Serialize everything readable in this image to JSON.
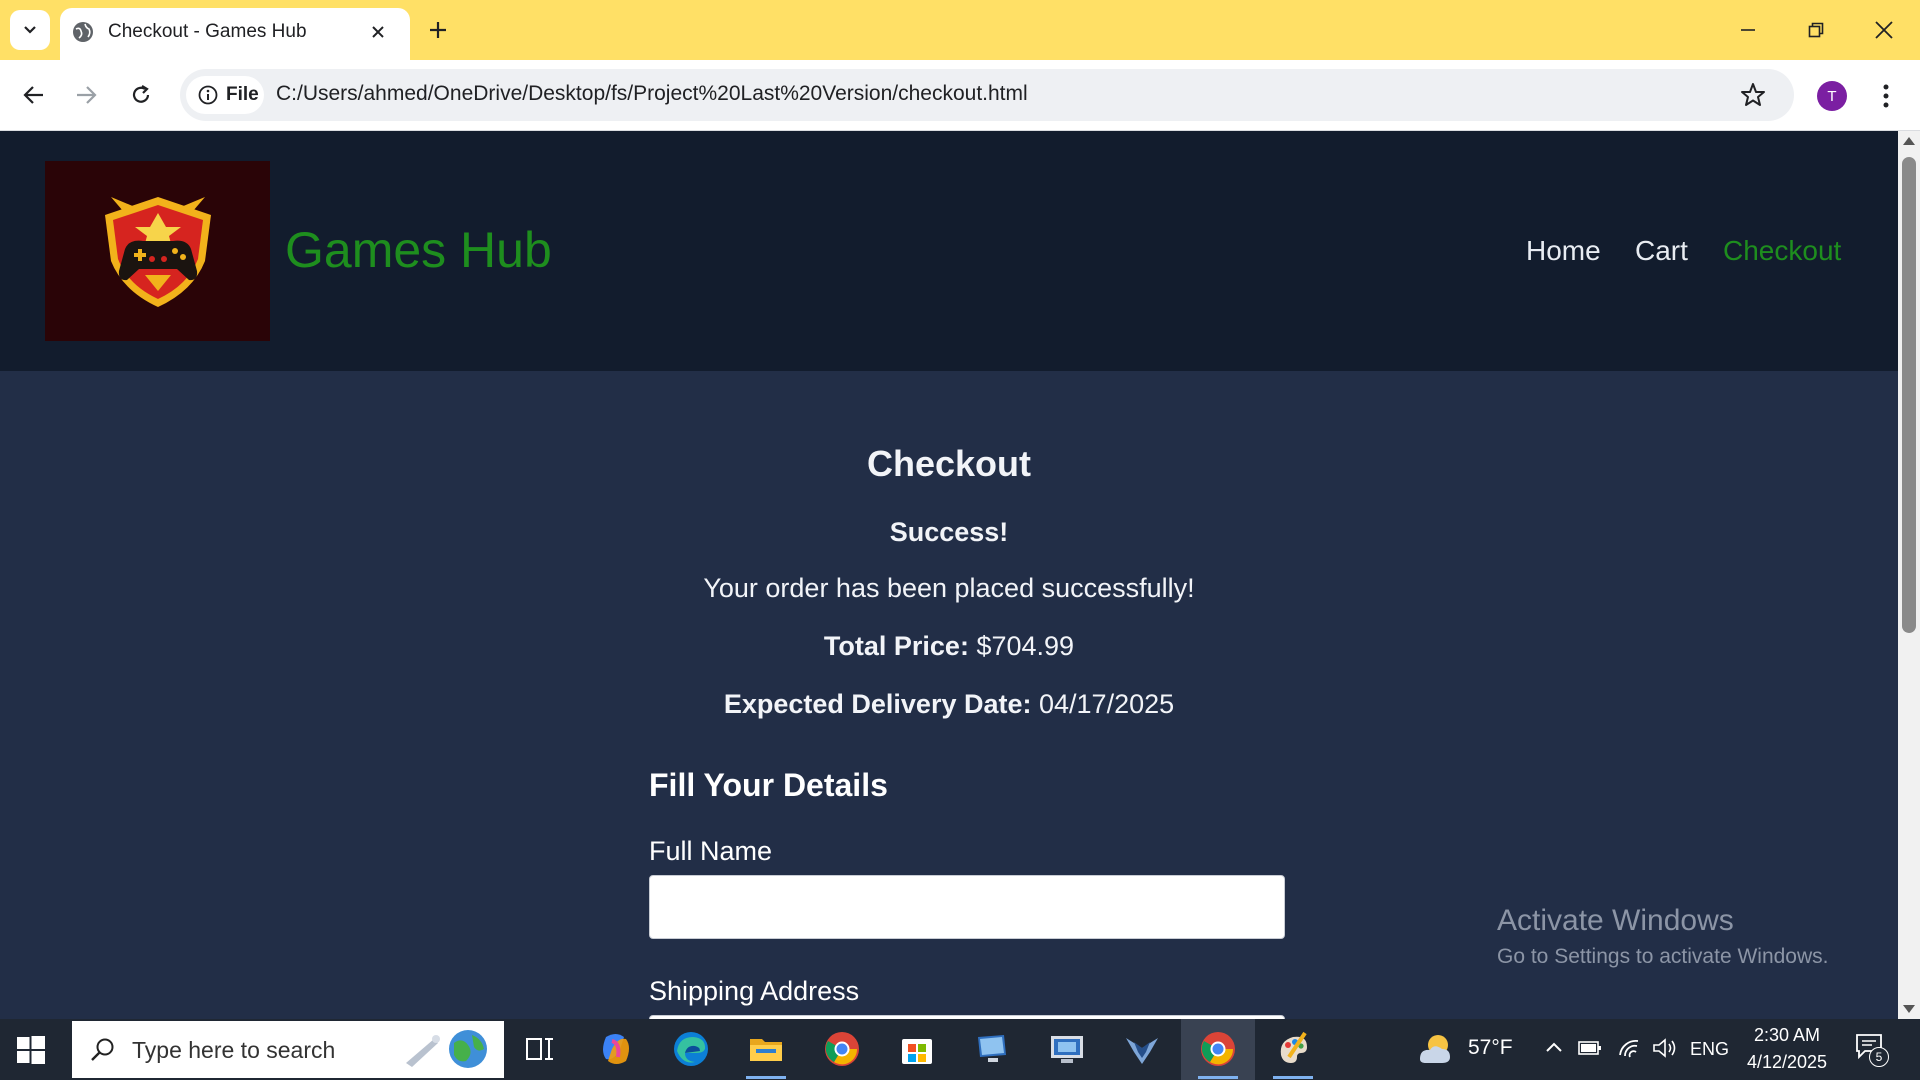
{
  "browser": {
    "tab_title": "Checkout - Games Hub",
    "url_chip": "File",
    "url": "C:/Users/ahmed/OneDrive/Desktop/fs/Project%20Last%20Version/checkout.html",
    "profile_initial": "T"
  },
  "site": {
    "brand": "Games Hub",
    "nav": [
      "Home",
      "Cart",
      "Checkout"
    ],
    "active_nav": "Checkout",
    "colors": {
      "brand_green": "#1e8e1e",
      "header_bg": "#121c2d",
      "page_bg": "#222e47"
    }
  },
  "checkout": {
    "title": "Checkout",
    "success": "Success!",
    "message": "Your order has been placed successfully!",
    "total_label": "Total Price:",
    "total_value": "$704.99",
    "delivery_label": "Expected Delivery Date:",
    "delivery_value": "04/17/2025"
  },
  "form": {
    "title": "Fill Your Details",
    "full_name_label": "Full Name",
    "full_name_value": "",
    "shipping_label": "Shipping Address"
  },
  "watermark": {
    "line1": "Activate Windows",
    "line2": "Go to Settings to activate Windows."
  },
  "taskbar": {
    "search_placeholder": "Type here to search",
    "weather": "57°F",
    "language": "ENG",
    "time": "2:30 AM",
    "date": "4/12/2025",
    "notification_count": "5"
  }
}
